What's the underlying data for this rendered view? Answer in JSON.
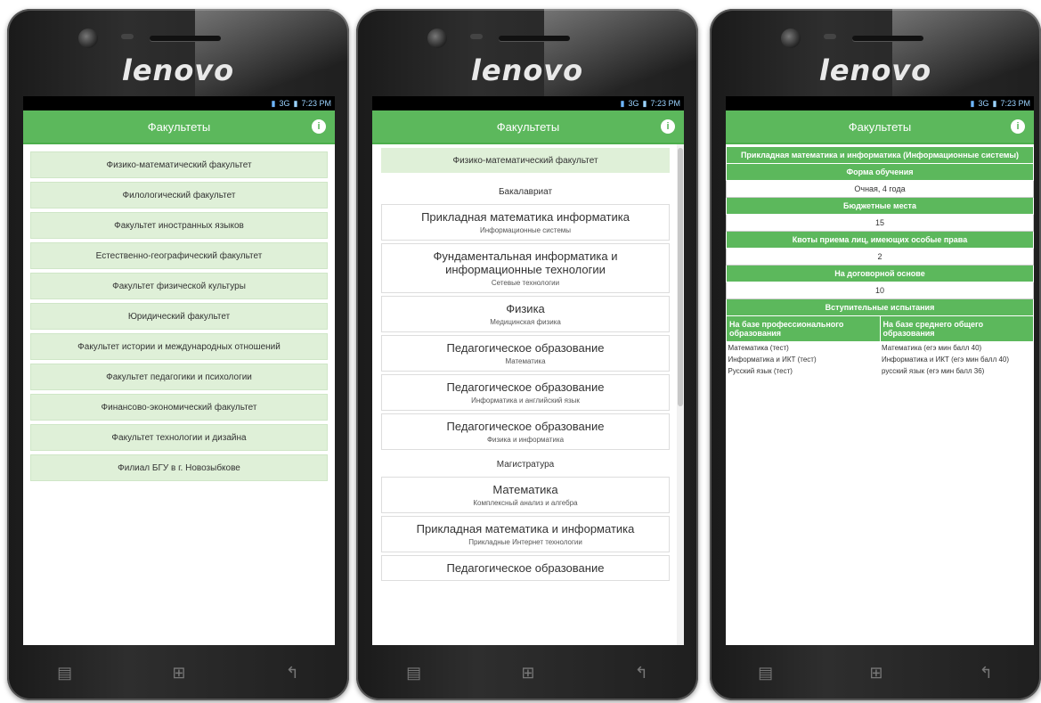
{
  "brand": "lenovo",
  "status": {
    "network": "3G",
    "time": "7:23 PM"
  },
  "appbar_title": "Факультеты",
  "info_icon": "info-icon",
  "accent_color": "#5cb85c",
  "faculties": [
    "Физико-математический факультет",
    "Филологический факультет",
    "Факультет иностранных языков",
    "Естественно-географический факультет",
    "Факультет физической культуры",
    "Юридический факультет",
    "Факультет истории и международных отношений",
    "Факультет педагогики и психологии",
    "Финансово-экономический факультет",
    "Факультет технологии и дизайна",
    "Филиал БГУ в г. Новозыбкове"
  ],
  "screen2": {
    "faculty": "Физико-математический факультет",
    "bachelor_label": "Бакалавриат",
    "bachelor_programs": [
      {
        "title": "Прикладная математика информатика",
        "sub": "Информационные системы"
      },
      {
        "title": "Фундаментальная информатика и информационные технологии",
        "sub": "Сетевые технологии"
      },
      {
        "title": "Физика",
        "sub": "Медицинская физика"
      },
      {
        "title": "Педагогическое образование",
        "sub": "Математика"
      },
      {
        "title": "Педагогическое образование",
        "sub": "Информатика и английский язык"
      },
      {
        "title": "Педагогическое образование",
        "sub": "Физика и информатика"
      }
    ],
    "master_label": "Магистратура",
    "master_programs": [
      {
        "title": "Математика",
        "sub": "Комплексный анализ и алгебра"
      },
      {
        "title": "Прикладная математика и информатика",
        "sub": "Прикладные Интернет технологии"
      },
      {
        "title": "Педагогическое образование",
        "sub": ""
      }
    ]
  },
  "screen3": {
    "program": "Прикладная математика и информатика (Информационные системы)",
    "form_label": "Форма обучения",
    "form_value": "Очная, 4 года",
    "budget_label": "Бюджетные места",
    "budget_value": "15",
    "quota_label": "Квоты приема лиц, имеющих особые права",
    "quota_value": "2",
    "contract_label": "На договорной основе",
    "contract_value": "10",
    "exams_label": "Вступительные испытания",
    "col_prof": "На базе профессионального образования",
    "col_general": "На базе среднего общего образования",
    "exam_rows": [
      {
        "prof": "Математика (тест)",
        "general": "Математика (егэ мин балл 40)"
      },
      {
        "prof": "Информатика и ИКТ (тест)",
        "general": "Информатика и ИКТ (егэ мин балл 40)"
      },
      {
        "prof": "Русский язык (тест)",
        "general": "русский язык (егэ мин балл 36)"
      }
    ]
  },
  "nav_icons": [
    "menu-icon",
    "home-icon",
    "back-icon"
  ]
}
